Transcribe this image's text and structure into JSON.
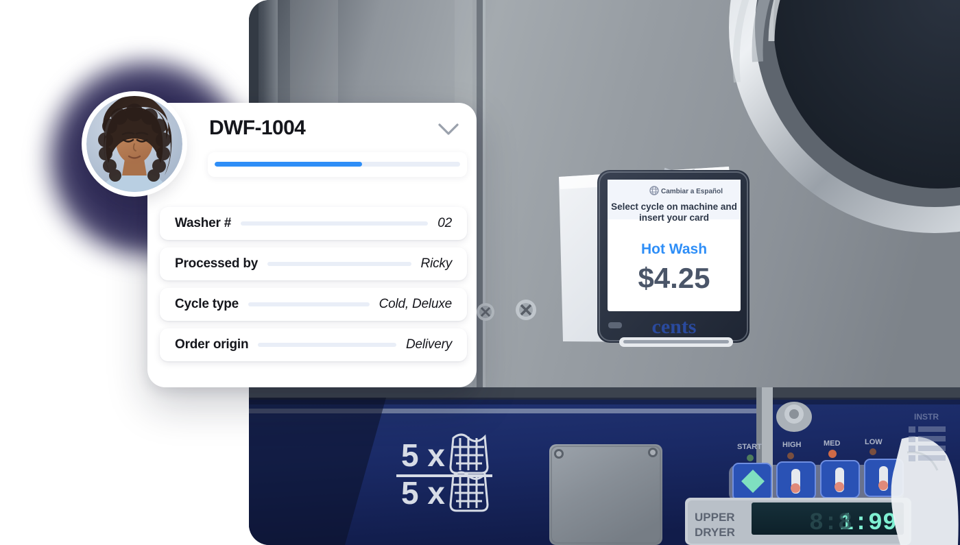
{
  "card": {
    "title": "DWF-1004",
    "chevron_icon": "chevron-down-icon",
    "progress": {
      "percent": 60,
      "fill_color": "#2e8ef7",
      "track_color": "#e9eef7"
    },
    "rows": [
      {
        "label": "Washer #",
        "value": "02"
      },
      {
        "label": "Processed by",
        "value": "Ricky"
      },
      {
        "label": "Cycle type",
        "value": "Cold, Deluxe"
      },
      {
        "label": "Order origin",
        "value": "Delivery"
      }
    ]
  },
  "avatar": {
    "icon": "avatar",
    "alt": "worker-portrait"
  },
  "photo": {
    "kiosk": {
      "language_toggle": "Cambiar a Español",
      "language_icon": "globe-icon",
      "instruction": "Select cycle on machine and insert your card",
      "cycle_name": "Hot Wash",
      "price": "$4.25",
      "brand": "cents",
      "cycle_color": "#2e8ef7",
      "price_color": "#4a5568",
      "brand_color": "#1f3a93"
    },
    "machine_label": {
      "top_count": "5 x",
      "bottom_count": "5 x",
      "basket_icon": "laundry-basket-icon"
    },
    "dryer_panel": {
      "buttons": [
        "START",
        "HIGH",
        "MED",
        "LOW"
      ],
      "display_value": "1:99",
      "display_color": "#7ff0d2",
      "panel_title_line1": "UPPER",
      "panel_title_line2": "DRYER"
    },
    "colors": {
      "machine_body": "#8c9198",
      "machine_blue": "#1a2a66",
      "door_dark": "#222a36"
    }
  }
}
